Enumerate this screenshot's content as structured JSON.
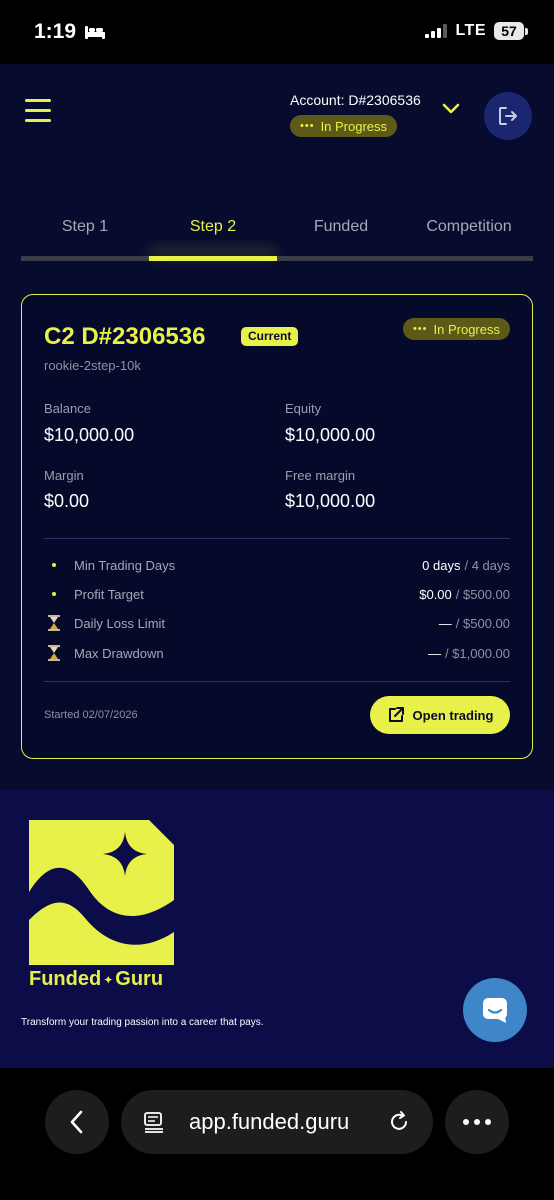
{
  "status_bar": {
    "time": "1:19",
    "network": "LTE",
    "battery": "57"
  },
  "header": {
    "account_label": "Account: D#2306536",
    "status_badge": "In Progress"
  },
  "tabs": [
    {
      "label": "Step 1",
      "active": false
    },
    {
      "label": "Step 2",
      "active": true
    },
    {
      "label": "Funded",
      "active": false
    },
    {
      "label": "Competition",
      "active": false
    }
  ],
  "card": {
    "title": "C2 D#2306536",
    "current_badge": "Current",
    "status_badge": "In Progress",
    "subtitle": "rookie-2step-10k",
    "stats": {
      "balance_label": "Balance",
      "balance_value": "$10,000.00",
      "equity_label": "Equity",
      "equity_value": "$10,000.00",
      "margin_label": "Margin",
      "margin_value": "$0.00",
      "free_margin_label": "Free margin",
      "free_margin_value": "$10,000.00"
    },
    "rules": [
      {
        "label": "Min Trading Days",
        "value": "0 days",
        "target": "/ 4 days",
        "icon": "dot"
      },
      {
        "label": "Profit Target",
        "value": "$0.00",
        "target": "/ $500.00",
        "icon": "dot"
      },
      {
        "label": "Daily Loss Limit",
        "value": "—",
        "target": "/ $500.00",
        "icon": "hourglass-icon"
      },
      {
        "label": "Max Drawdown",
        "value": "—",
        "target": "/ $1,000.00",
        "icon": "hourglass-icon"
      }
    ],
    "started": "Started 02/07/2026",
    "open_trading_label": "Open trading"
  },
  "footer": {
    "brand_name_part1": "Funded",
    "brand_name_part2": "Guru",
    "tagline": "Transform your trading passion into a career that pays."
  },
  "browser": {
    "url": "app.funded.guru"
  },
  "colors": {
    "accent": "#e8f04a",
    "background": "#070b2d",
    "footer_bg": "#0b0c48",
    "chat": "#3f86c8"
  }
}
